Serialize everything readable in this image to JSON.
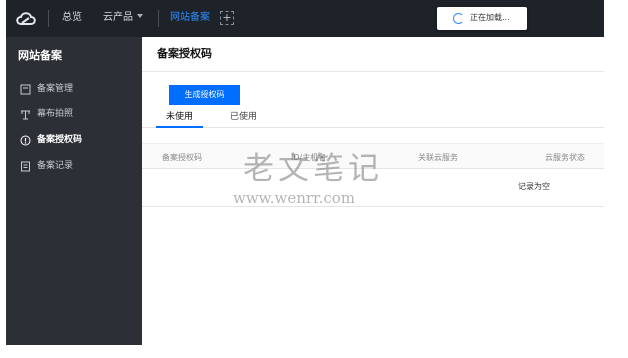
{
  "topbar": {
    "nav": {
      "overview": "总览",
      "products": "云产品",
      "current": "网站备案"
    },
    "plus": "+",
    "loading_text": "正在加载..."
  },
  "sidebar": {
    "title": "网站备案",
    "items": [
      {
        "label": "备案管理",
        "icon": "doc-square-icon",
        "active": false
      },
      {
        "label": "幕布拍照",
        "icon": "camera-stand-icon",
        "active": false
      },
      {
        "label": "备案授权码",
        "icon": "info-circle-icon",
        "active": true
      },
      {
        "label": "备案记录",
        "icon": "record-list-icon",
        "active": false
      }
    ]
  },
  "main": {
    "title": "备案授权码",
    "generate_button": "生成授权码",
    "tabs": [
      {
        "label": "未使用",
        "active": true
      },
      {
        "label": "已使用",
        "active": false
      }
    ],
    "table": {
      "columns": [
        "备案授权码",
        "ID/主机名",
        "关联云服务",
        "云服务状态"
      ],
      "empty_text": "记录为空"
    }
  },
  "watermark": {
    "cn": "老文笔记",
    "en": "www.wenrr.com"
  },
  "colors": {
    "topbar_bg": "#1e2229",
    "sidebar_bg": "#2c3036",
    "accent": "#006eff"
  }
}
